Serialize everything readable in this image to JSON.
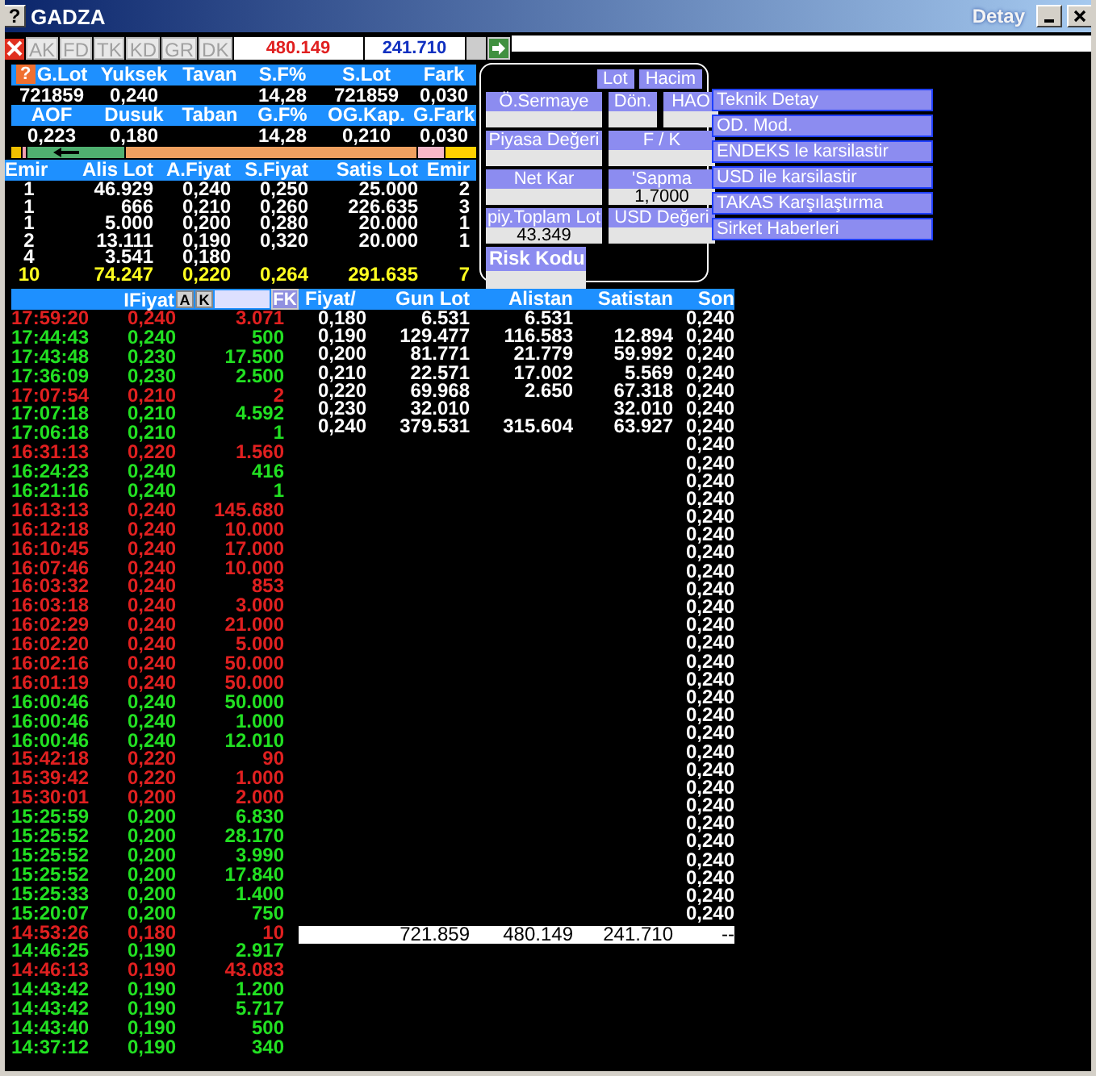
{
  "window": {
    "icon": "?",
    "title": "GADZA"
  },
  "summary_help": "?",
  "detail_window": {
    "title": "Detay"
  },
  "toolbar": {
    "buttons": [
      "AK",
      "FD",
      "TK",
      "KD",
      "GR",
      "DK"
    ],
    "value_1": "480.149",
    "value_2": "241.710"
  },
  "summary": [
    {
      "header": "G.Lot",
      "value": "721859"
    },
    {
      "header": "Yuksek",
      "value": "0,240"
    },
    {
      "header": "Tavan"
    },
    {
      "header": "S.F%",
      "value": "14,28"
    },
    {
      "header": "S.Lot",
      "value": "721859"
    },
    {
      "header": "Fark",
      "value": "0,030"
    },
    {
      "header": "AOF",
      "value": "0,223"
    },
    {
      "header": "Dusuk",
      "value": "0,180"
    },
    {
      "header": "Taban"
    },
    {
      "header": "G.F%",
      "value": "14,28"
    },
    {
      "header": "OG.Kap.",
      "value": "0,210"
    },
    {
      "header": "G.Fark",
      "value": "0,030"
    }
  ],
  "order_book": {
    "columns": [
      "Emir",
      "Alis Lot",
      "A.Fiyat",
      "S.Fiyat",
      "Satis Lot",
      "Emir"
    ],
    "rows": [
      {
        "kind": "level",
        "cells": [
          "1",
          "46.929",
          "0,240",
          "0,250",
          "25.000",
          "2"
        ]
      },
      {
        "kind": "level",
        "cells": [
          "1",
          "666",
          "0,210",
          "0,260",
          "226.635",
          "3"
        ]
      },
      {
        "kind": "level",
        "cells": [
          "1",
          "5.000",
          "0,200",
          "0,280",
          "20.000",
          "1"
        ]
      },
      {
        "kind": "level",
        "cells": [
          "2",
          "13.111",
          "0,190",
          "0,320",
          "20.000",
          "1"
        ]
      },
      {
        "kind": "level",
        "cells": [
          "4",
          "3.541",
          "0,180"
        ]
      },
      {
        "kind": "total",
        "cells": [
          "10",
          "74.247",
          "0,220",
          "0,264",
          "291.635",
          "7"
        ]
      }
    ]
  },
  "info_panel": {
    "buttons": [
      "Lot",
      "Hacim"
    ],
    "rows": [
      [
        {
          "label": "Ö.Sermaye"
        },
        {
          "label": "Dön."
        },
        {
          "label": "HAO"
        }
      ],
      [
        {
          "label": "Piyasa Değeri"
        },
        {
          "label": "F / K"
        }
      ],
      [
        {
          "label": "Net Kar"
        },
        {
          "label": "'Sapma",
          "value": "1,7000"
        }
      ],
      [
        {
          "label": "piy.Toplam Lot",
          "value": "43.349"
        },
        {
          "label": "USD Değeri"
        }
      ],
      [
        {
          "label": "Risk Kodu",
          "kind": "big"
        }
      ]
    ]
  },
  "menu": [
    "Teknik Detay",
    "OD. Mod.",
    "ENDEKS le karsilastir",
    "USD ile karsilastir",
    "TAKAS Karşılaştırma",
    "Sirket Haberleri"
  ],
  "trades": {
    "header": "IFiyat",
    "buttons": [
      "A",
      "K"
    ],
    "fk_button": "FK",
    "rows": [
      {
        "time": "17:59:20",
        "price": "0,240",
        "lot": "3.071",
        "color": "#e02020"
      },
      {
        "time": "17:44:43",
        "price": "0,240",
        "lot": "500",
        "color": "#22e022"
      },
      {
        "time": "17:43:48",
        "price": "0,230",
        "lot": "17.500",
        "color": "#22e022"
      },
      {
        "time": "17:36:09",
        "price": "0,230",
        "lot": "2.500",
        "color": "#22e022"
      },
      {
        "time": "17:07:54",
        "price": "0,210",
        "lot": "2",
        "color": "#e02020"
      },
      {
        "time": "17:07:18",
        "price": "0,210",
        "lot": "4.592",
        "color": "#22e022"
      },
      {
        "time": "17:06:18",
        "price": "0,210",
        "lot": "1",
        "color": "#22e022"
      },
      {
        "time": "16:31:13",
        "price": "0,220",
        "lot": "1.560",
        "color": "#e02020"
      },
      {
        "time": "16:24:23",
        "price": "0,240",
        "lot": "416",
        "color": "#22e022"
      },
      {
        "time": "16:21:16",
        "price": "0,240",
        "lot": "1",
        "color": "#22e022"
      },
      {
        "time": "16:13:13",
        "price": "0,240",
        "lot": "145.680",
        "color": "#e02020"
      },
      {
        "time": "16:12:18",
        "price": "0,240",
        "lot": "10.000",
        "color": "#e02020"
      },
      {
        "time": "16:10:45",
        "price": "0,240",
        "lot": "17.000",
        "color": "#e02020"
      },
      {
        "time": "16:07:46",
        "price": "0,240",
        "lot": "10.000",
        "color": "#e02020"
      },
      {
        "time": "16:03:32",
        "price": "0,240",
        "lot": "853",
        "color": "#e02020"
      },
      {
        "time": "16:03:18",
        "price": "0,240",
        "lot": "3.000",
        "color": "#e02020"
      },
      {
        "time": "16:02:29",
        "price": "0,240",
        "lot": "21.000",
        "color": "#e02020"
      },
      {
        "time": "16:02:20",
        "price": "0,240",
        "lot": "5.000",
        "color": "#e02020"
      },
      {
        "time": "16:02:16",
        "price": "0,240",
        "lot": "50.000",
        "color": "#e02020"
      },
      {
        "time": "16:01:19",
        "price": "0,240",
        "lot": "50.000",
        "color": "#e02020"
      },
      {
        "time": "16:00:46",
        "price": "0,240",
        "lot": "50.000",
        "color": "#22e022"
      },
      {
        "time": "16:00:46",
        "price": "0,240",
        "lot": "1.000",
        "color": "#22e022"
      },
      {
        "time": "16:00:46",
        "price": "0,240",
        "lot": "12.010",
        "color": "#22e022"
      },
      {
        "time": "15:42:18",
        "price": "0,220",
        "lot": "90",
        "color": "#e02020"
      },
      {
        "time": "15:39:42",
        "price": "0,220",
        "lot": "1.000",
        "color": "#e02020"
      },
      {
        "time": "15:30:01",
        "price": "0,200",
        "lot": "2.000",
        "color": "#e02020"
      },
      {
        "time": "15:25:59",
        "price": "0,200",
        "lot": "6.830",
        "color": "#22e022"
      },
      {
        "time": "15:25:52",
        "price": "0,200",
        "lot": "28.170",
        "color": "#22e022"
      },
      {
        "time": "15:25:52",
        "price": "0,200",
        "lot": "3.990",
        "color": "#22e022"
      },
      {
        "time": "15:25:52",
        "price": "0,200",
        "lot": "17.840",
        "color": "#22e022"
      },
      {
        "time": "15:25:33",
        "price": "0,200",
        "lot": "1.400",
        "color": "#22e022"
      },
      {
        "time": "15:20:07",
        "price": "0,200",
        "lot": "750",
        "color": "#22e022"
      },
      {
        "time": "14:53:26",
        "price": "0,180",
        "lot": "10",
        "color": "#e02020"
      },
      {
        "time": "14:46:25",
        "price": "0,190",
        "lot": "2.917",
        "color": "#22e022"
      },
      {
        "time": "14:46:13",
        "price": "0,190",
        "lot": "43.083",
        "color": "#e02020"
      },
      {
        "time": "14:43:42",
        "price": "0,190",
        "lot": "1.200",
        "color": "#22e022"
      },
      {
        "time": "14:43:42",
        "price": "0,190",
        "lot": "5.717",
        "color": "#22e022"
      },
      {
        "time": "14:43:40",
        "price": "0,190",
        "lot": "500",
        "color": "#22e022"
      },
      {
        "time": "14:37:12",
        "price": "0,190",
        "lot": "340",
        "color": "#22e022"
      }
    ]
  },
  "price_table": {
    "columns": [
      "Fiyat/",
      "Gun Lot",
      "Alistan",
      "Satistan",
      "Son"
    ],
    "rows": [
      {
        "price": "0,180",
        "day_lot": "6.531",
        "bid": "6.531"
      },
      {
        "price": "0,190",
        "day_lot": "129.477",
        "bid": "116.583",
        "ask": "12.894"
      },
      {
        "price": "0,200",
        "day_lot": "81.771",
        "bid": "21.779",
        "ask": "59.992"
      },
      {
        "price": "0,210",
        "day_lot": "22.571",
        "bid": "17.002",
        "ask": "5.569"
      },
      {
        "price": "0,220",
        "day_lot": "69.968",
        "bid": "2.650",
        "ask": "67.318"
      },
      {
        "price": "0,230",
        "day_lot": "32.010",
        "ask": "32.010"
      },
      {
        "price": "0,240",
        "day_lot": "379.531",
        "bid": "315.604",
        "ask": "63.927"
      }
    ],
    "last_prices": [
      "0,240",
      "0,240",
      "0,240",
      "0,240",
      "0,240",
      "0,240",
      "0,240",
      "0,240",
      "0,240",
      "0,240",
      "0,240",
      "0,240",
      "0,240",
      "0,240",
      "0,240",
      "0,240",
      "0,240",
      "0,240",
      "0,240",
      "0,240",
      "0,240",
      "0,240",
      "0,240",
      "0,240",
      "0,240",
      "0,240",
      "0,240",
      "0,240",
      "0,240",
      "0,240",
      "0,240",
      "0,240",
      "0,240",
      "0,240"
    ],
    "totals": {
      "day_lot": "721.859",
      "bid": "480.149",
      "ask": "241.710",
      "last": "--"
    }
  }
}
